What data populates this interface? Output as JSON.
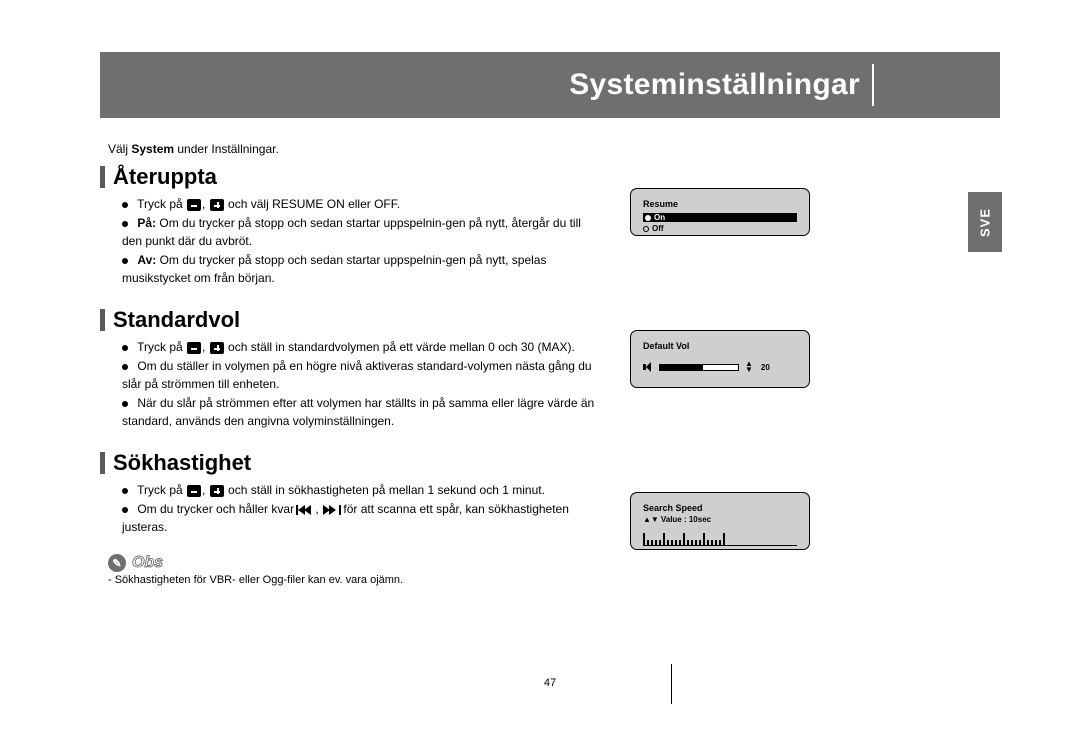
{
  "header": {
    "title": "Systeminställningar"
  },
  "side_tab": "SVE",
  "intro": {
    "prefix": "Välj ",
    "bold": "System",
    "suffix": " under Inställningar."
  },
  "sections": {
    "resume": {
      "title": "Återuppta",
      "line1a": "Tryck på ",
      "line1b": " och välj RESUME ON eller OFF.",
      "on_label": "På:",
      "on_text": " Om du trycker på stopp och sedan startar uppspelnin-gen på nytt, återgår du till den punkt där du avbröt.",
      "off_label": "Av:",
      "off_text": " Om du trycker på stopp och sedan startar uppspelnin-gen på nytt, spelas musikstycket om från början."
    },
    "defaultvol": {
      "title": "Standardvol",
      "line1a": "Tryck på ",
      "line1b": " och ställ in standardvolymen på ett värde mellan 0 och 30 (MAX).",
      "line2": "Om du ställer in volymen på en högre nivå aktiveras standard-volymen nästa gång du slår på strömmen till enheten.",
      "line3": "När du slår på strömmen efter att volymen har ställts in på samma eller lägre värde än standard, används den angivna volyminställningen."
    },
    "search": {
      "title": "Sökhastighet",
      "line1a": "Tryck på ",
      "line1b": " och ställ in sökhastigheten på mellan 1 sekund och 1 minut.",
      "line2a": "Om du trycker och håller kvar ",
      "line2b": " för att scanna ett spår, kan sökhastigheten justeras."
    }
  },
  "osd": {
    "resume": {
      "title": "Resume",
      "on": "On",
      "off": "Off"
    },
    "defaultvol": {
      "title": "Default Vol",
      "value": "20"
    },
    "searchspeed": {
      "title": "Search Speed",
      "value_label": "Value : 10sec"
    }
  },
  "note": {
    "label": "Obs",
    "text": "- Sökhastigheten för VBR- eller Ogg-filer kan ev. vara ojämn."
  },
  "page_number": "47",
  "icons": {
    "minus": "minus",
    "plus": "plus",
    "rew": "skip-back",
    "ff": "skip-forward"
  }
}
